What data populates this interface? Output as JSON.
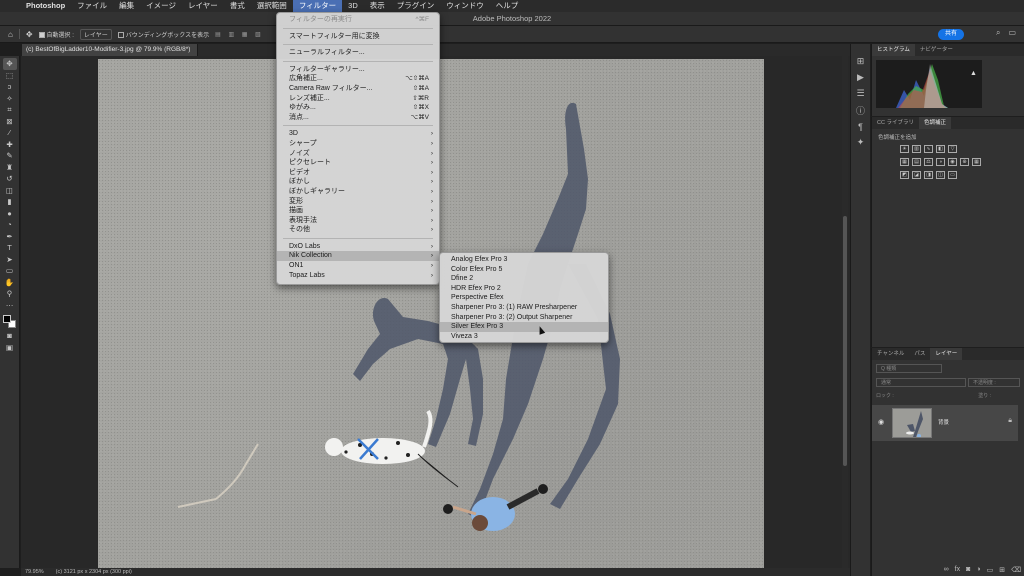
{
  "menubar": {
    "app": "Photoshop",
    "items": [
      "ファイル",
      "編集",
      "イメージ",
      "レイヤー",
      "書式",
      "選択範囲",
      "フィルター",
      "3D",
      "表示",
      "プラグイン",
      "ウィンドウ",
      "ヘルプ"
    ],
    "active_index": 6
  },
  "window": {
    "title": "Adobe Photoshop 2022"
  },
  "options": {
    "auto_select_label": "自動選択 :",
    "layer_select": "レイヤー",
    "bounding_box_label": "バウンディングボックスを表示",
    "share_label": "共有"
  },
  "document": {
    "tab_title": "(c) BestOfBigLadder10-Modifier-3.jpg @ 79.9% (RGB/8*)",
    "zoom": "79.95%",
    "size_info": "(c) 3121 px x 2304 px (300 ppi)"
  },
  "filter_menu": {
    "last_filter": "フィルターの再実行",
    "last_filter_shortcut": "^⌘F",
    "smart_filter": "スマートフィルター用に変換",
    "neural": "ニューラルフィルター...",
    "gallery": "フィルターギャラリー...",
    "wide_angle": "広角補正...",
    "wide_angle_shortcut": "⌥⇧⌘A",
    "camera_raw": "Camera Raw フィルター...",
    "camera_raw_shortcut": "⇧⌘A",
    "lens": "レンズ補正...",
    "lens_shortcut": "⇧⌘R",
    "liquify": "ゆがみ...",
    "liquify_shortcut": "⇧⌘X",
    "vanishing": "消点...",
    "vanishing_shortcut": "⌥⌘V",
    "groups": [
      "3D",
      "シャープ",
      "ノイズ",
      "ピクセレート",
      "ビデオ",
      "ぼかし",
      "ぼかしギャラリー",
      "変形",
      "描画",
      "表現手法",
      "その他"
    ],
    "plugins": [
      "DxO Labs",
      "Nik Collection",
      "ON1",
      "Topaz Labs"
    ],
    "highlighted_plugin": "Nik Collection"
  },
  "nik_menu": {
    "items": [
      "Analog Efex Pro 3",
      "Color Efex Pro 5",
      "Dfine 2",
      "HDR Efex Pro 2",
      "Perspective Efex",
      "Sharpener Pro 3: (1) RAW Presharpener",
      "Sharpener Pro 3: (2) Output Sharpener",
      "Silver Efex Pro 3",
      "Viveza 3"
    ],
    "highlighted": "Silver Efex Pro 3"
  },
  "panels": {
    "top_tabs": [
      "ヒストグラム",
      "ナビゲーター"
    ],
    "mid_tabs": [
      "CC ライブラリ",
      "色調補正"
    ],
    "adjust_label": "色調補正を追加",
    "layer_tabs": [
      "チャンネル",
      "パス",
      "レイヤー"
    ],
    "layer_search": "Q 種類",
    "blend_mode": "通常",
    "opacity_label": "不透明度 :",
    "lock_label": "ロック :",
    "fill_label": "塗り :",
    "layer_name": "背景"
  },
  "colors": {
    "accent": "#1473e6",
    "menu_bg": "#d6d6d6",
    "highlight": "#b4b4b4"
  }
}
